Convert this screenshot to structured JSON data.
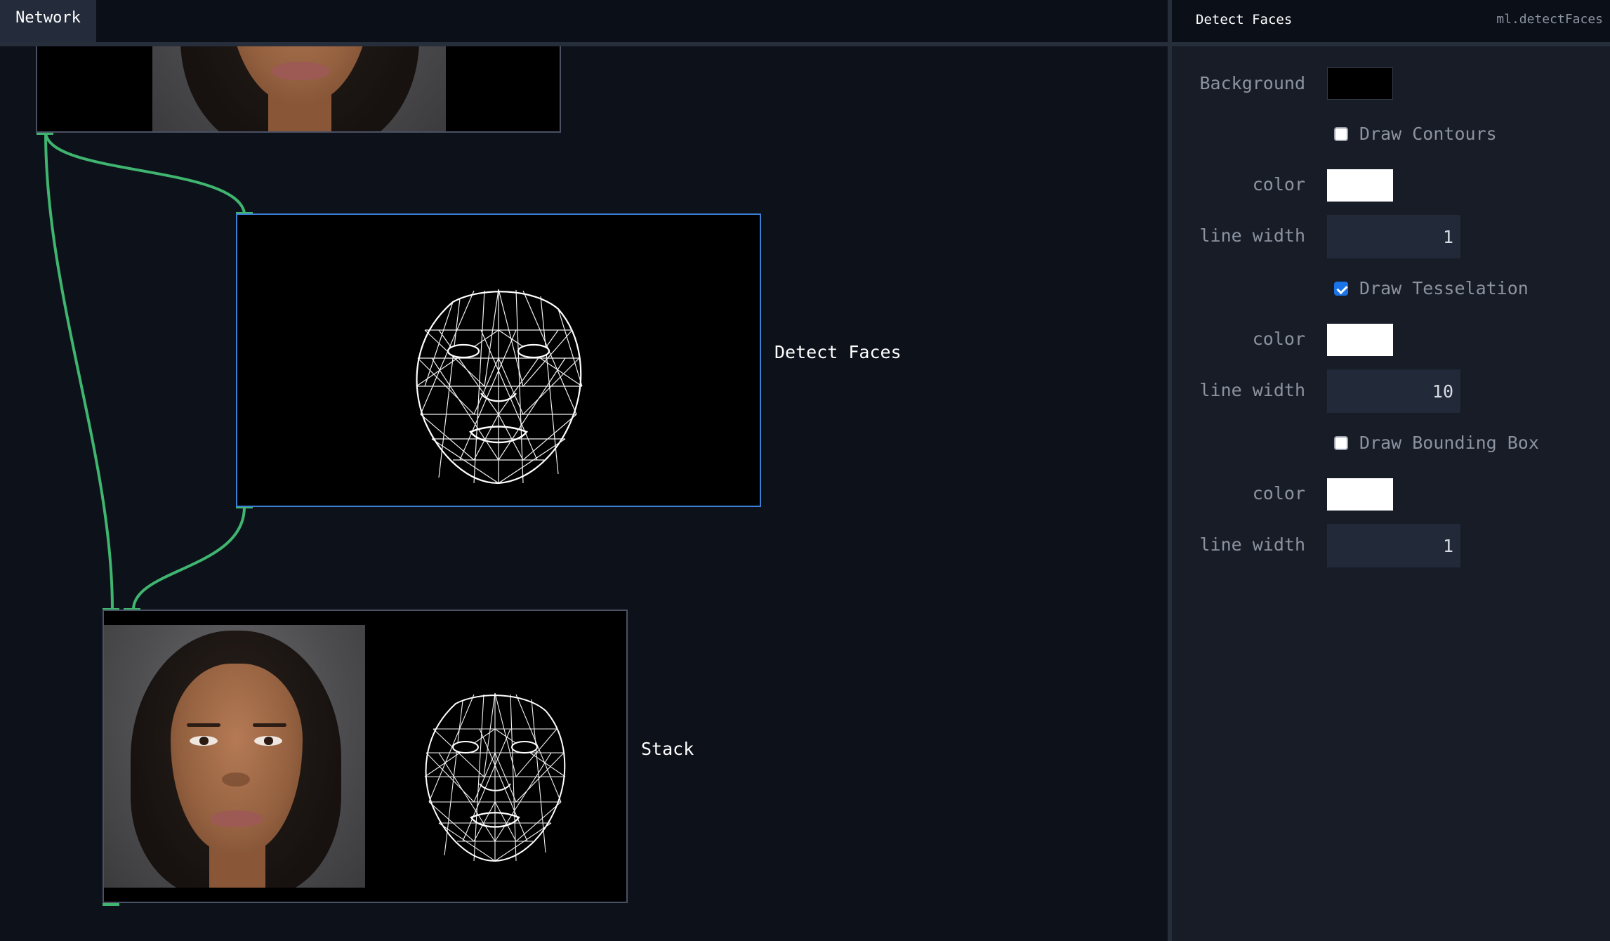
{
  "network": {
    "tab_label": "Network",
    "nodes": [
      {
        "id": "input-image",
        "label": ""
      },
      {
        "id": "detect-faces",
        "label": "Detect Faces"
      },
      {
        "id": "stack",
        "label": "Stack"
      }
    ]
  },
  "inspector": {
    "title": "Detect Faces",
    "node_type": "ml.detectFaces",
    "background": {
      "label": "Background",
      "color": "#000000"
    },
    "contours": {
      "label": "Draw Contours",
      "checked": false,
      "color_label": "color",
      "color": "#ffffff",
      "line_width_label": "line width",
      "line_width": "1"
    },
    "tesselation": {
      "label": "Draw Tesselation",
      "checked": true,
      "color_label": "color",
      "color": "#ffffff",
      "line_width_label": "line width",
      "line_width": "10"
    },
    "bounding_box": {
      "label": "Draw Bounding Box",
      "checked": false,
      "color_label": "color",
      "color": "#ffffff",
      "line_width_label": "line width",
      "line_width": "1"
    }
  },
  "colors": {
    "wire": "#3fb56f",
    "selected_border": "#3d7fd6",
    "node_border": "#4a5163",
    "panel_bg": "#171c27",
    "canvas_bg": "#0d111a"
  }
}
